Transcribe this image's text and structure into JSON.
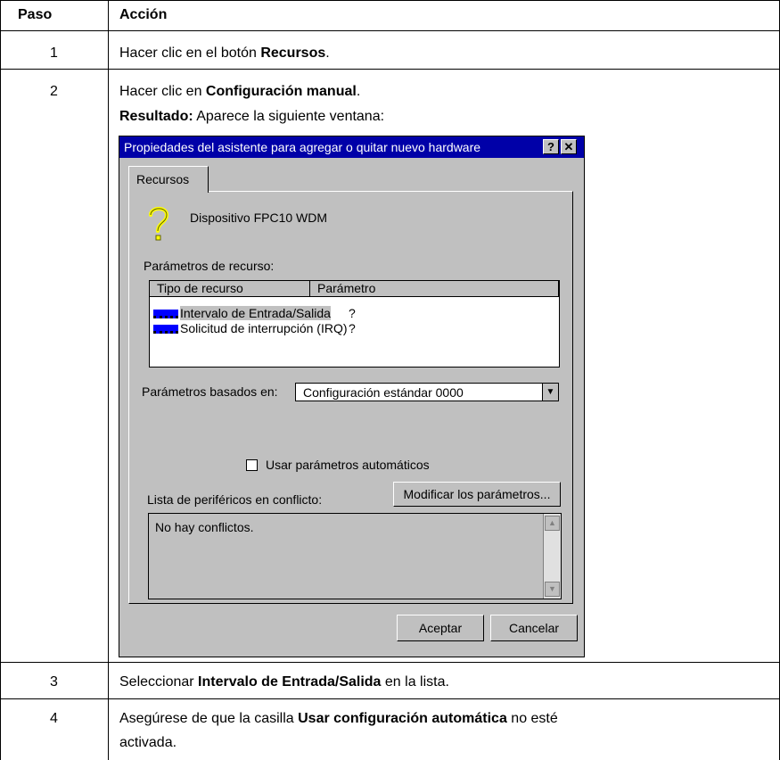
{
  "table": {
    "header": {
      "paso": "Paso",
      "accion": "Acción"
    },
    "rows": [
      {
        "num": "1",
        "pre": "Hacer clic en el botón ",
        "bold": "Recursos",
        "post": "."
      },
      {
        "num": "2",
        "line1_pre": "Hacer clic en ",
        "line1_bold": "Configuración manual",
        "line1_post": ".",
        "line2_bold": "Resultado:",
        "line2_post": " Aparece la siguiente ventana:"
      },
      {
        "num": "3",
        "pre": "Seleccionar ",
        "bold": "Intervalo de Entrada/Salida",
        "post": " en la lista."
      },
      {
        "num": "4",
        "pre": "Asegúrese de que la casilla ",
        "bold": "Usar configuración automática",
        "post": " no esté",
        "line2": "activada."
      }
    ]
  },
  "dialog": {
    "title": "Propiedades del asistente para agregar o quitar nuevo hardware",
    "help_button": "?",
    "close_button": "✕",
    "tab": "Recursos",
    "device_icon": "question-mark-icon",
    "device_name": "Dispositivo FPC10 WDM",
    "resource_params_label": "Parámetros de recurso:",
    "columns": [
      "Tipo de recurso",
      "Parámetro"
    ],
    "resources": [
      {
        "type": "Intervalo de Entrada/Salida",
        "value": "?"
      },
      {
        "type": "Solicitud de interrupción (IRQ)",
        "value": "?"
      }
    ],
    "based_on_label": "Parámetros basados en:",
    "based_on_value": "Configuración estándar 0000",
    "auto_checkbox_label": "Usar parámetros automáticos",
    "auto_checked": false,
    "conflict_label": "Lista de periféricos en conflicto:",
    "modify_button": "Modificar los parámetros...",
    "conflicts_text": "No hay conflictos.",
    "ok_button": "Aceptar",
    "cancel_button": "Cancelar",
    "colors": {
      "title_bar": "#0000a8",
      "face": "#c0c0c0",
      "chip": "#0000ff"
    }
  }
}
